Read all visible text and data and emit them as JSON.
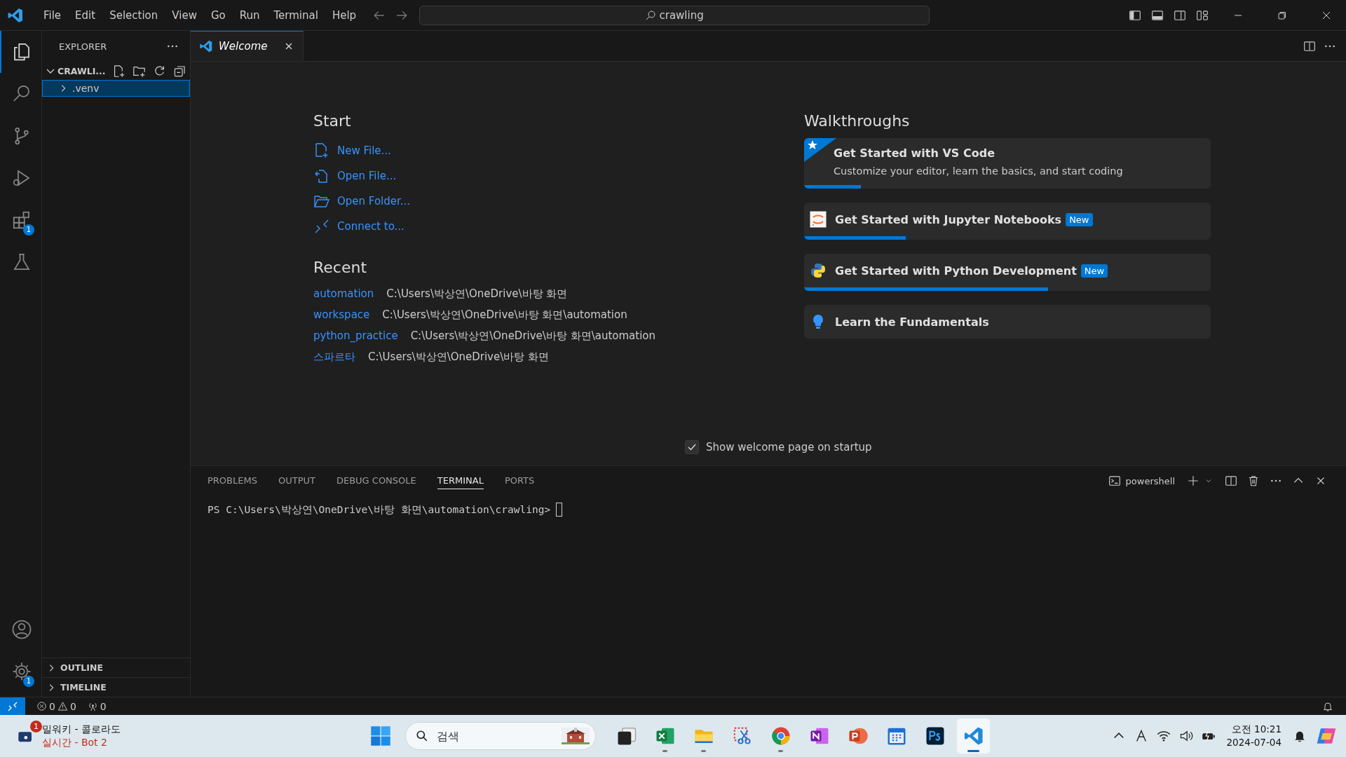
{
  "title_bar": {
    "menu": [
      "File",
      "Edit",
      "Selection",
      "View",
      "Go",
      "Run",
      "Terminal",
      "Help"
    ],
    "search": "crawling"
  },
  "activity_bar": {
    "items": [
      {
        "kind": "explorer",
        "selected": true
      },
      {
        "kind": "search",
        "selected": false
      },
      {
        "kind": "source-control",
        "selected": false
      },
      {
        "kind": "run",
        "selected": false
      },
      {
        "kind": "extensions",
        "selected": false,
        "badge": "1"
      },
      {
        "kind": "testing",
        "selected": false
      }
    ],
    "bottom": [
      {
        "kind": "account"
      },
      {
        "kind": "manage",
        "badge": "1"
      }
    ]
  },
  "sidebar": {
    "title": "EXPLORER",
    "folder": {
      "label": "CRAWLI...",
      "expanded": true,
      "children": [
        {
          "label": ".venv",
          "expanded": false,
          "selected": true
        }
      ]
    },
    "sections": [
      {
        "label": "OUTLINE",
        "expanded": false
      },
      {
        "label": "TIMELINE",
        "expanded": false
      }
    ]
  },
  "tabs": [
    {
      "label": "Welcome",
      "selected": true
    }
  ],
  "welcome": {
    "start_title": "Start",
    "start": [
      {
        "kind": "new-file",
        "label": "New File..."
      },
      {
        "kind": "open-file",
        "label": "Open File..."
      },
      {
        "kind": "open-folder",
        "label": "Open Folder..."
      },
      {
        "kind": "connect",
        "label": "Connect to..."
      }
    ],
    "recent_title": "Recent",
    "recent": [
      {
        "name": "automation",
        "path": "C:\\Users\\박상연\\OneDrive\\바탕 화면"
      },
      {
        "name": "workspace",
        "path": "C:\\Users\\박상연\\OneDrive\\바탕 화면\\automation"
      },
      {
        "name": "python_practice",
        "path": "C:\\Users\\박상연\\OneDrive\\바탕 화면\\automation"
      },
      {
        "name": "스파르타",
        "path": "C:\\Users\\박상연\\OneDrive\\바탕 화면"
      }
    ],
    "walkthroughs_title": "Walkthroughs",
    "walkthroughs": [
      {
        "kind": "star",
        "title": "Get Started with VS Code",
        "description": "Customize your editor, learn the basics, and start coding",
        "level": 0.14
      },
      {
        "kind": "jupyter",
        "title": "Get Started with Jupyter Notebooks",
        "badge": "New",
        "level": 0.25
      },
      {
        "kind": "python",
        "title": "Get Started with Python Development",
        "badge": "New",
        "level": 0.6
      },
      {
        "kind": "bulb",
        "title": "Learn the Fundamentals"
      }
    ],
    "show_on_startup": {
      "label": "Show welcome page on startup",
      "checked": true
    }
  },
  "panel": {
    "tabs": [
      {
        "label": "PROBLEMS",
        "selected": false
      },
      {
        "label": "OUTPUT",
        "selected": false
      },
      {
        "label": "DEBUG CONSOLE",
        "selected": false
      },
      {
        "label": "TERMINAL",
        "selected": true
      },
      {
        "label": "PORTS",
        "selected": false
      }
    ],
    "shell": "powershell",
    "terminal_line": "PS C:\\Users\\박상연\\OneDrive\\바탕 화면\\automation\\crawling>"
  },
  "status_bar": {
    "errors": "0",
    "warnings": "0",
    "ports": "0"
  },
  "taskbar": {
    "widget": {
      "badge": "1",
      "line1": "밀워키 - 콜로라도",
      "line2": "실시간 - Bot 2"
    },
    "search_placeholder": "검색",
    "apps": [
      {
        "kind": "task-view",
        "running": false,
        "selected": false
      },
      {
        "kind": "excel",
        "running": true,
        "selected": false
      },
      {
        "kind": "files",
        "running": true,
        "selected": false
      },
      {
        "kind": "snip",
        "running": false,
        "selected": false
      },
      {
        "kind": "chrome",
        "running": true,
        "selected": false
      },
      {
        "kind": "onenote",
        "running": false,
        "selected": false
      },
      {
        "kind": "powerpoint",
        "running": false,
        "selected": false
      },
      {
        "kind": "calendar",
        "running": false,
        "selected": false
      },
      {
        "kind": "photoshop",
        "running": false,
        "selected": false
      },
      {
        "kind": "vscode",
        "running": true,
        "selected": true
      }
    ],
    "time": "오전 10:21",
    "date": "2024-07-04"
  }
}
